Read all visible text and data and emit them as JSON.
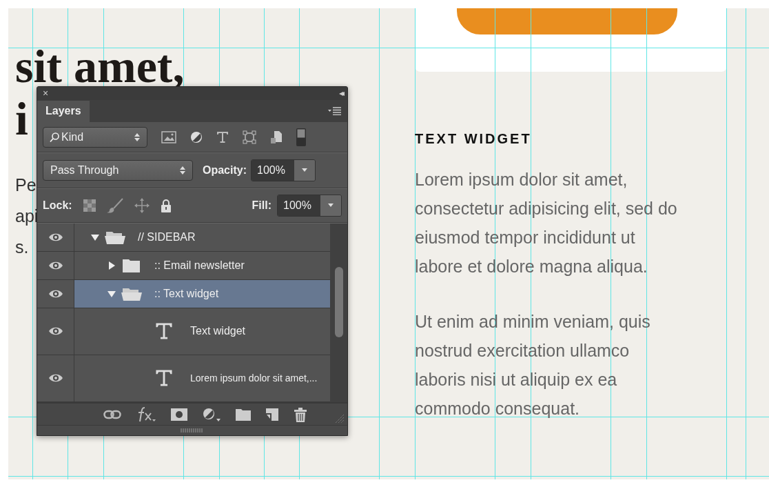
{
  "canvas": {
    "left_heading": [
      "sit amet,",
      "i"
    ],
    "left_text": [
      "Pe",
      "api",
      "s."
    ],
    "widget_title": "TEXT WIDGET",
    "paragraphs": [
      "Lorem ipsum dolor sit amet,\nconsectetur adipisicing elit, sed do\neiusmod tempor incididunt ut\nlabore et dolore magna aliqua.",
      "Ut enim ad minim veniam, quis\nnostrud exercitation ullamco\nlaboris nisi ut aliquip ex ea\ncommodo consequat."
    ]
  },
  "panel": {
    "close": "×",
    "collapse": "◂◂",
    "tab": "Layers",
    "filter": {
      "value": "Kind"
    },
    "blend_mode": "Pass Through",
    "opacity_label": "Opacity:",
    "opacity": "100%",
    "lock_label": "Lock:",
    "fill_label": "Fill:",
    "fill": "100%",
    "layers": [
      {
        "kind": "group",
        "name": "// SIDEBAR",
        "visible": true,
        "expanded": true,
        "selected": false,
        "children": [
          {
            "kind": "group",
            "name": ":: Email newsletter",
            "visible": true,
            "expanded": false,
            "selected": false
          },
          {
            "kind": "group",
            "name": ":: Text widget",
            "visible": true,
            "expanded": true,
            "selected": true,
            "children": [
              {
                "kind": "text",
                "name": "Text widget",
                "visible": true,
                "selected": false
              },
              {
                "kind": "text",
                "name": "Lorem ipsum dolor sit amet,...",
                "visible": true,
                "selected": false
              }
            ]
          }
        ]
      }
    ]
  }
}
